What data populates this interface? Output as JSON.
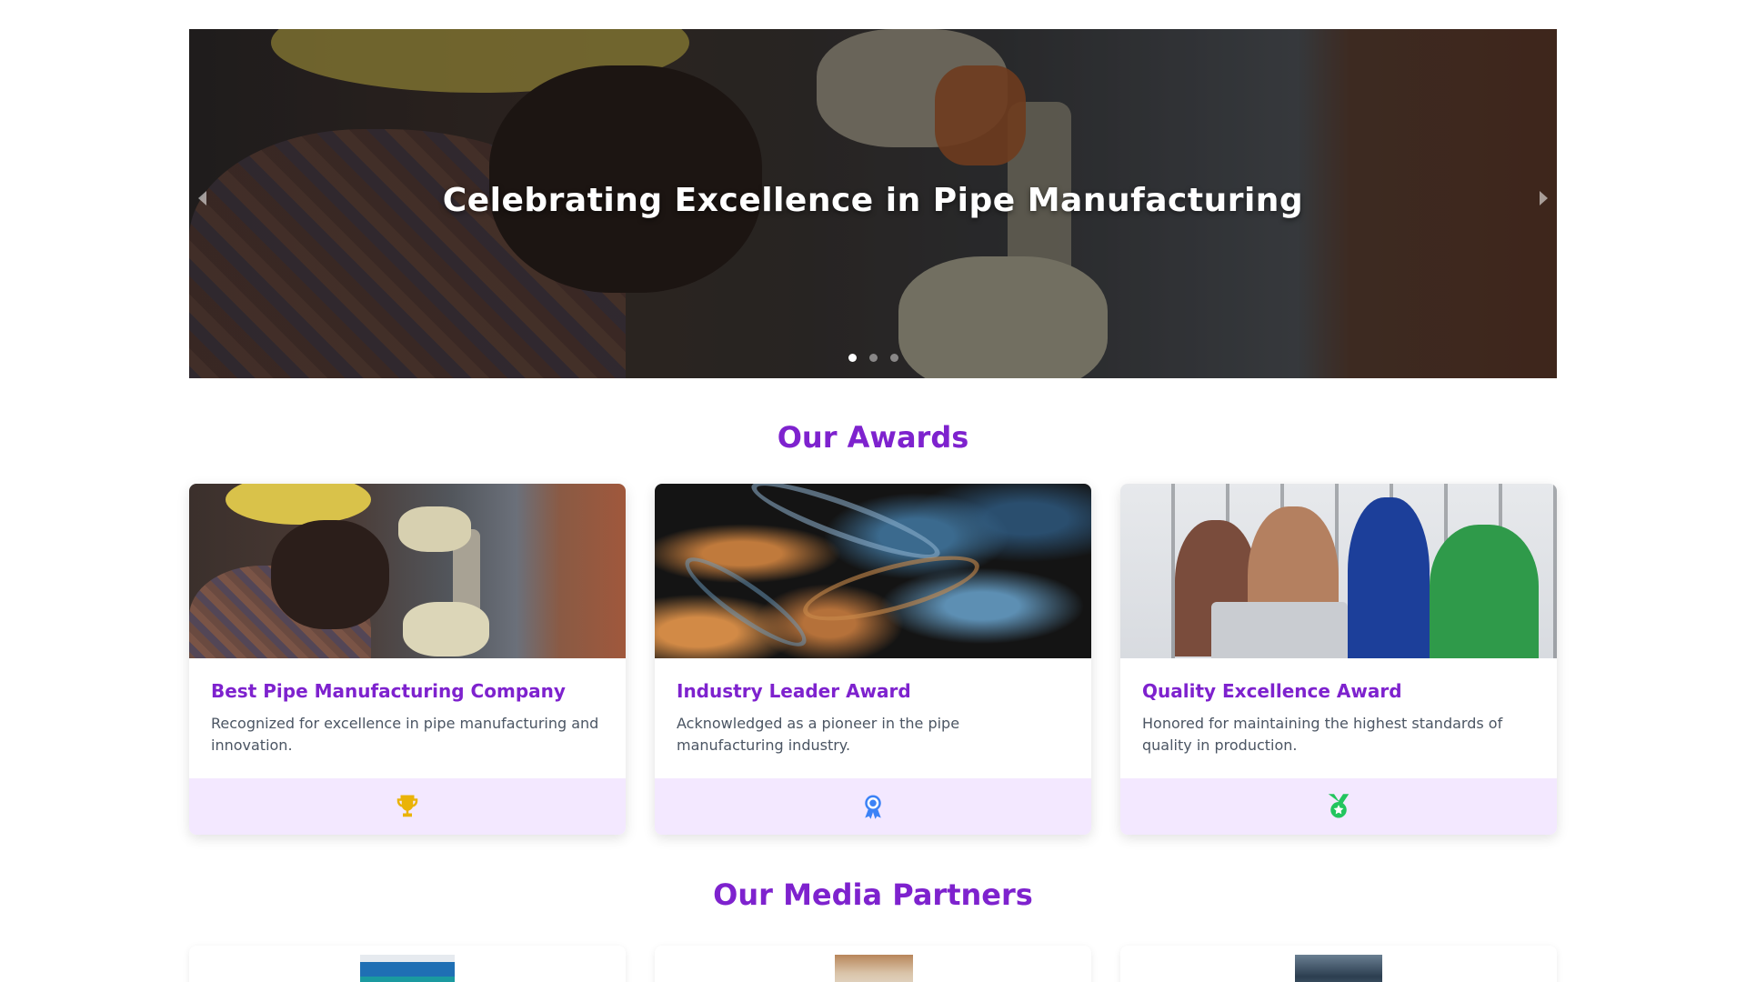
{
  "hero": {
    "title": "Celebrating Excellence in Pipe Manufacturing",
    "slide_count": 3,
    "active_slide": 1
  },
  "awards": {
    "heading": "Our Awards",
    "items": [
      {
        "title": "Best Pipe Manufacturing Company",
        "description": "Recognized for excellence in pipe manufacturing and innovation.",
        "icon": "trophy-icon",
        "icon_color": "#eab308"
      },
      {
        "title": "Industry Leader Award",
        "description": "Acknowledged as a pioneer in the pipe manufacturing industry.",
        "icon": "award-ribbon-icon",
        "icon_color": "#3b82f6"
      },
      {
        "title": "Quality Excellence Award",
        "description": "Honored for maintaining the highest standards of quality in production.",
        "icon": "medal-icon",
        "icon_color": "#22c55e"
      }
    ]
  },
  "partners": {
    "heading": "Our Media Partners"
  },
  "colors": {
    "accent": "#7e22ce",
    "card_footer_bg": "#f3e8ff"
  }
}
